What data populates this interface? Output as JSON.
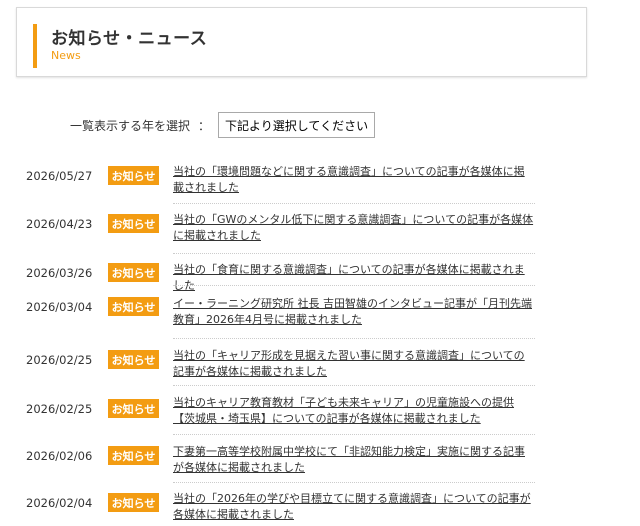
{
  "header": {
    "title": "お知らせ・ニュース",
    "subtitle": "News",
    "accent_color": "#f39c12"
  },
  "year_filter": {
    "label": "一覧表示する年を選択",
    "colon": "：",
    "selected": "下記より選択してください"
  },
  "news": [
    {
      "date": "2026/05/27",
      "badge": "お知らせ",
      "title": "当社の「環境問題などに関する意識調査」についての記事が各媒体に掲載されました"
    },
    {
      "date": "2026/04/23",
      "badge": "お知らせ",
      "title": "当社の「GWのメンタル低下に関する意識調査」についての記事が各媒体に掲載されました"
    },
    {
      "date": "2026/03/26",
      "badge": "お知らせ",
      "title": "当社の「食育に関する意識調査」についての記事が各媒体に掲載されました"
    },
    {
      "date": "2026/03/04",
      "badge": "お知らせ",
      "title": "イー・ラーニング研究所 社長 吉田智雄のインタビュー記事が「月刊先端教育」2026年4月号に掲載されました"
    },
    {
      "date": "2026/02/25",
      "badge": "お知らせ",
      "title": "当社の「キャリア形成を見据えた習い事に関する意識調査」についての記事が各媒体に掲載されました"
    },
    {
      "date": "2026/02/25",
      "badge": "お知らせ",
      "title": "当社のキャリア教育教材「子ども未来キャリア」の児童施設への提供【茨城県・埼玉県】についての記事が各媒体に掲載されました"
    },
    {
      "date": "2026/02/06",
      "badge": "お知らせ",
      "title": "下妻第一高等学校附属中学校にて「非認知能力検定」実施に関する記事が各媒体に掲載されました"
    },
    {
      "date": "2026/02/04",
      "badge": "お知らせ",
      "title": "当社の「2026年の学びや目標立てに関する意識調査」についての記事が各媒体に掲載されました"
    }
  ]
}
